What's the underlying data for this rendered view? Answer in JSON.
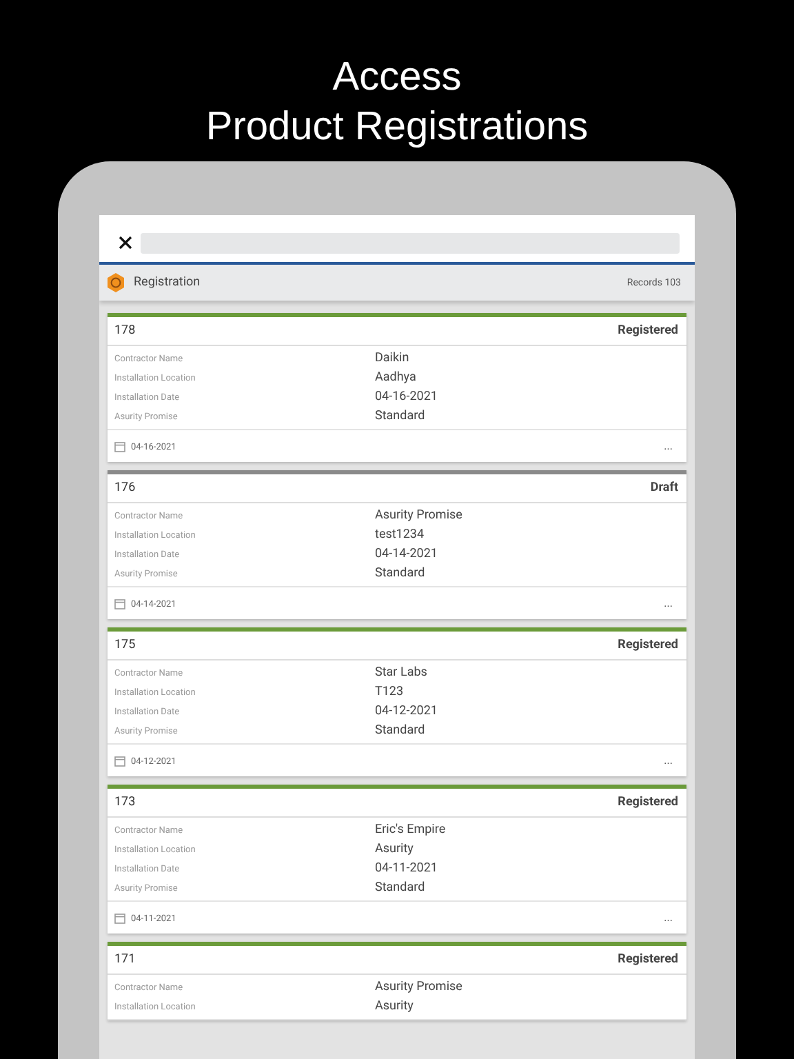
{
  "headline": [
    "Access",
    "Product Registrations"
  ],
  "section": {
    "title": "Registration",
    "count": "Records 103"
  },
  "cards": [
    {
      "number": "178",
      "status": "Registered",
      "color": "#6b9b3a",
      "fields": [
        {
          "label": "Contractor Name",
          "value": "Daikin"
        },
        {
          "label": "Installation Location",
          "value": "Aadhya"
        },
        {
          "label": "Installation Date",
          "value": "04-16-2021"
        },
        {
          "label": "Asurity Promise",
          "value": "Standard"
        }
      ],
      "date": "04-16-2021",
      "more": "..."
    },
    {
      "number": "176",
      "status": "Draft",
      "color": "#8a8a8a",
      "fields": [
        {
          "label": "Contractor Name",
          "value": "Asurity Promise"
        },
        {
          "label": "Installation Location",
          "value": "test1234"
        },
        {
          "label": "Installation Date",
          "value": "04-14-2021"
        },
        {
          "label": "Asurity Promise",
          "value": "Standard"
        }
      ],
      "date": "04-14-2021",
      "more": "..."
    },
    {
      "number": "175",
      "status": "Registered",
      "color": "#6b9b3a",
      "fields": [
        {
          "label": "Contractor Name",
          "value": "Star Labs"
        },
        {
          "label": "Installation Location",
          "value": "T123"
        },
        {
          "label": "Installation Date",
          "value": "04-12-2021"
        },
        {
          "label": "Asurity Promise",
          "value": "Standard"
        }
      ],
      "date": "04-12-2021",
      "more": "..."
    },
    {
      "number": "173",
      "status": "Registered",
      "color": "#6b9b3a",
      "fields": [
        {
          "label": "Contractor Name",
          "value": "Eric's Empire"
        },
        {
          "label": "Installation Location",
          "value": "Asurity"
        },
        {
          "label": "Installation Date",
          "value": "04-11-2021"
        },
        {
          "label": "Asurity Promise",
          "value": "Standard"
        }
      ],
      "date": "04-11-2021",
      "more": "..."
    },
    {
      "number": "171",
      "status": "Registered",
      "color": "#6b9b3a",
      "fields": [
        {
          "label": "Contractor Name",
          "value": "Asurity Promise"
        },
        {
          "label": "Installation Location",
          "value": "Asurity"
        }
      ]
    }
  ]
}
